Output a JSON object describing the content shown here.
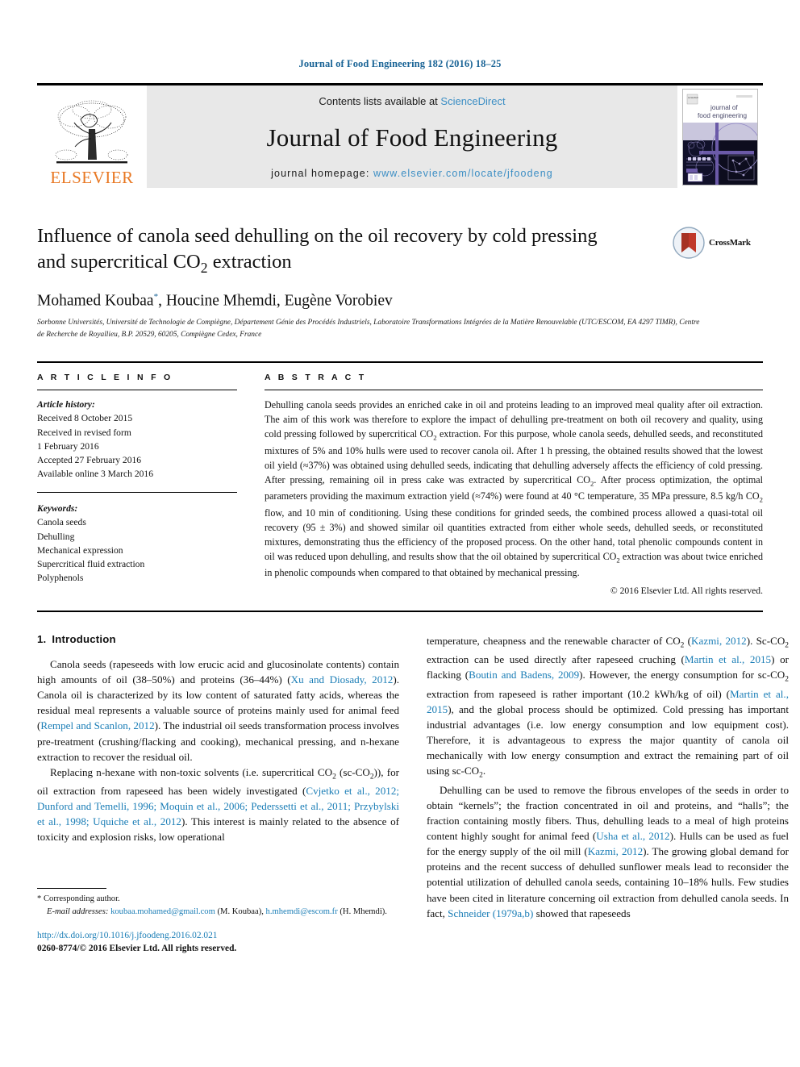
{
  "running_head": "Journal of Food Engineering 182 (2016) 18–25",
  "masthead": {
    "publisher_logo_text": "ELSEVIER",
    "contents_prefix": "Contents lists available at ",
    "contents_link": "ScienceDirect",
    "journal_name": "Journal of Food Engineering",
    "homepage_prefix": "journal homepage: ",
    "homepage_url": "www.elsevier.com/locate/jfoodeng",
    "cover_title_line1": "journal of",
    "cover_title_line2": "food engineering"
  },
  "article": {
    "title_line1": "Influence of canola seed dehulling on the oil recovery by cold pressing",
    "title_line2_pre": "and supercritical CO",
    "title_line2_sub": "2",
    "title_line2_post": " extraction",
    "crossmark_label": "CrossMark",
    "authors": "Mohamed Koubaa",
    "author_mark": "*",
    "authors_rest": ", Houcine Mhemdi, Eugène Vorobiev",
    "affiliation": "Sorbonne Universités, Université de Technologie de Compiègne, Département Génie des Procédés Industriels, Laboratoire Transformations Intégrées de la Matière Renouvelable (UTC/ESCOM, EA 4297 TIMR), Centre de Recherche de Royallieu, B.P. 20529, 60205, Compiègne Cedex, France"
  },
  "info": {
    "heading": "A R T I C L E    I N F O",
    "history_title": "Article history:",
    "history": [
      "Received 8 October 2015",
      "Received in revised form",
      "1 February 2016",
      "Accepted 27 February 2016",
      "Available online 3 March 2016"
    ],
    "keywords_title": "Keywords:",
    "keywords": [
      "Canola seeds",
      "Dehulling",
      "Mechanical expression",
      "Supercritical fluid extraction",
      "Polyphenols"
    ]
  },
  "abstract": {
    "heading": "A B S T R A C T",
    "text": "Dehulling canola seeds provides an enriched cake in oil and proteins leading to an improved meal quality after oil extraction. The aim of this work was therefore to explore the impact of dehulling pre-treatment on both oil recovery and quality, using cold pressing followed by supercritical CO₂ extraction. For this purpose, whole canola seeds, dehulled seeds, and reconstituted mixtures of 5% and 10% hulls were used to recover canola oil. After 1 h pressing, the obtained results showed that the lowest oil yield (≈37%) was obtained using dehulled seeds, indicating that dehulling adversely affects the efficiency of cold pressing. After pressing, remaining oil in press cake was extracted by supercritical CO₂. After process optimization, the optimal parameters providing the maximum extraction yield (≈74%) were found at 40 °C temperature, 35 MPa pressure, 8.5 kg/h CO₂ flow, and 10 min of conditioning. Using these conditions for grinded seeds, the combined process allowed a quasi-total oil recovery (95 ± 3%) and showed similar oil quantities extracted from either whole seeds, dehulled seeds, or reconstituted mixtures, demonstrating thus the efficiency of the proposed process. On the other hand, total phenolic compounds content in oil was reduced upon dehulling, and results show that the oil obtained by supercritical CO₂ extraction was about twice enriched in phenolic compounds when compared to that obtained by mechanical pressing.",
    "copyright": "© 2016 Elsevier Ltd. All rights reserved."
  },
  "introduction": {
    "number": "1.",
    "heading": "Introduction",
    "left_paragraphs": [
      "Canola seeds (rapeseeds with low erucic acid and glucosinolate contents) contain high amounts of oil (38–50%) and proteins (36–44%) (Xu and Diosady, 2012). Canola oil is characterized by its low content of saturated fatty acids, whereas the residual meal represents a valuable source of proteins mainly used for animal feed (Rempel and Scanlon, 2012). The industrial oil seeds transformation process involves pre-treatment (crushing/flacking and cooking), mechanical pressing, and n-hexane extraction to recover the residual oil.",
      "Replacing n-hexane with non-toxic solvents (i.e. supercritical CO₂ (sc-CO₂)), for oil extraction from rapeseed has been widely investigated (Cvjetko et al., 2012; Dunford and Temelli, 1996; Moquin et al., 2006; Pederssetti et al., 2011; Przybylski et al., 1998; Uquiche et al., 2012). This interest is mainly related to the absence of toxicity and explosion risks, low operational"
    ],
    "right_paragraphs": [
      "temperature, cheapness and the renewable character of CO₂ (Kazmi, 2012). Sc-CO₂ extraction can be used directly after rapeseed cruching (Martin et al., 2015) or flacking (Boutin and Badens, 2009). However, the energy consumption for sc-CO₂ extraction from rapeseed is rather important (10.2 kWh/kg of oil) (Martin et al., 2015), and the global process should be optimized. Cold pressing has important industrial advantages (i.e. low energy consumption and low equipment cost). Therefore, it is advantageous to express the major quantity of canola oil mechanically with low energy consumption and extract the remaining part of oil using sc-CO₂.",
      "Dehulling can be used to remove the fibrous envelopes of the seeds in order to obtain “kernels”; the fraction concentrated in oil and proteins, and “halls”; the fraction containing mostly fibers. Thus, dehulling leads to a meal of high proteins content highly sought for animal feed (Usha et al., 2012). Hulls can be used as fuel for the energy supply of the oil mill (Kazmi, 2012). The growing global demand for proteins and the recent success of dehulled sunflower meals lead to reconsider the potential utilization of dehulled canola seeds, containing 10–18% hulls. Few studies have been cited in literature concerning oil extraction from dehulled canola seeds. In fact, Schneider (1979a,b) showed that rapeseeds"
    ]
  },
  "footnotes": {
    "corresponding_marker": "*",
    "corresponding_text": "Corresponding author.",
    "email_label": "E-mail addresses:",
    "email_1": "koubaa.mohamed@gmail.com",
    "email_1_name": "(M. Koubaa),",
    "email_2": "h.mhemdi@escom.fr",
    "email_2_name": "(H. Mhemdi).",
    "doi": "http://dx.doi.org/10.1016/j.jfoodeng.2016.02.021",
    "issn_line": "0260-8774/© 2016 Elsevier Ltd. All rights reserved."
  },
  "colors": {
    "link_blue": "#1a7db6",
    "header_blue": "#1a6496",
    "sciencedirect_blue": "#3c8ec4",
    "elsevier_orange": "#E87722",
    "band_gray": "#e8e8e8",
    "crossmark_red": "#c0392b",
    "cover_purple": "#6b5aa8"
  }
}
